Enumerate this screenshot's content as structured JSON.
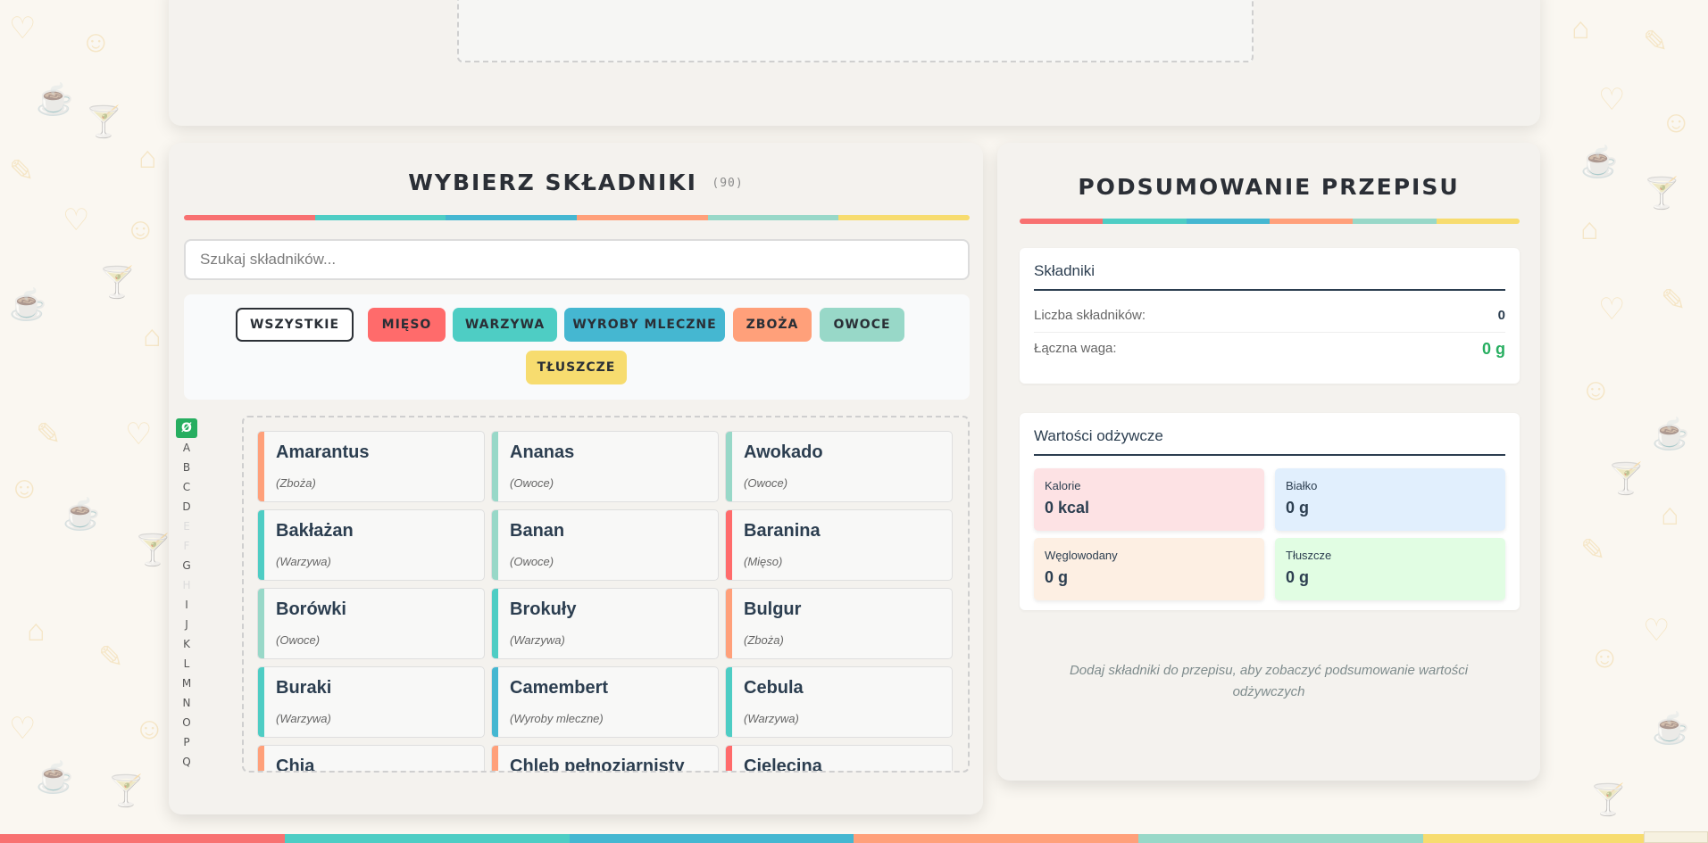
{
  "colors": {
    "stripe": [
      "#f87171",
      "#4ecdc4",
      "#45b7d1",
      "#ffa07a",
      "#98d8c8",
      "#f7dc6f"
    ],
    "chips": {
      "miesa": "#ff6b6b",
      "warzywa": "#4ecdc4",
      "nabial": "#45b7d1",
      "zboza": "#ffa07a",
      "owoce": "#98d8c8",
      "tluszcze": "#f7dc6f"
    }
  },
  "ingredients_panel": {
    "title": "WYBIERZ SKŁADNIKI",
    "count": "(90)",
    "search_placeholder": "Szukaj składników...",
    "filters": [
      {
        "label": "WSZYSTKIE",
        "active": true
      },
      {
        "label": "MIĘSO"
      },
      {
        "label": "WARZYWA"
      },
      {
        "label": "WYROBY MLECZNE"
      },
      {
        "label": "ZBOŻA"
      },
      {
        "label": "OWOCE"
      },
      {
        "label": "TŁUSZCZE"
      }
    ],
    "letters": [
      {
        "char": "Ø",
        "state": "active"
      },
      {
        "char": "A"
      },
      {
        "char": "B"
      },
      {
        "char": "C"
      },
      {
        "char": "D"
      },
      {
        "char": "E",
        "state": "dim"
      },
      {
        "char": "F",
        "state": "dim"
      },
      {
        "char": "G"
      },
      {
        "char": "H",
        "state": "dim"
      },
      {
        "char": "I"
      },
      {
        "char": "J"
      },
      {
        "char": "K"
      },
      {
        "char": "L"
      },
      {
        "char": "M"
      },
      {
        "char": "N"
      },
      {
        "char": "O"
      },
      {
        "char": "P"
      },
      {
        "char": "Q"
      }
    ],
    "items": [
      {
        "name": "Amarantus",
        "category": "(Zboża)",
        "cat": "zboza"
      },
      {
        "name": "Ananas",
        "category": "(Owoce)",
        "cat": "owoce"
      },
      {
        "name": "Awokado",
        "category": "(Owoce)",
        "cat": "owoce"
      },
      {
        "name": "Bakłażan",
        "category": "(Warzywa)",
        "cat": "warzywa"
      },
      {
        "name": "Banan",
        "category": "(Owoce)",
        "cat": "owoce"
      },
      {
        "name": "Baranina",
        "category": "(Mięso)",
        "cat": "miesa"
      },
      {
        "name": "Borówki",
        "category": "(Owoce)",
        "cat": "owoce"
      },
      {
        "name": "Brokuły",
        "category": "(Warzywa)",
        "cat": "warzywa"
      },
      {
        "name": "Bulgur",
        "category": "(Zboża)",
        "cat": "zboza"
      },
      {
        "name": "Buraki",
        "category": "(Warzywa)",
        "cat": "warzywa"
      },
      {
        "name": "Camembert",
        "category": "(Wyroby mleczne)",
        "cat": "nabial"
      },
      {
        "name": "Cebula",
        "category": "(Warzywa)",
        "cat": "warzywa"
      },
      {
        "name": "Chia",
        "category": "",
        "cat": "zboza"
      },
      {
        "name": "Chleb pełnoziarnisty",
        "category": "",
        "cat": "zboza"
      },
      {
        "name": "Cielęcina",
        "category": "",
        "cat": "miesa"
      }
    ]
  },
  "summary_panel": {
    "title": "PODSUMOWANIE PRZEPISU",
    "ingredients_section": {
      "heading": "Składniki",
      "count_label": "Liczba składników:",
      "count_value": "0",
      "weight_label": "Łączna waga:",
      "weight_value": "0 g"
    },
    "nutrition_section": {
      "heading": "Wartości odżywcze",
      "items": [
        {
          "label": "Kalorie",
          "value": "0 kcal",
          "bg": "#fde2e4"
        },
        {
          "label": "Białko",
          "value": "0 g",
          "bg": "#e1effd"
        },
        {
          "label": "Węglowodany",
          "value": "0 g",
          "bg": "#fdefe3"
        },
        {
          "label": "Tłuszcze",
          "value": "0 g",
          "bg": "#e1fde3"
        }
      ]
    },
    "hint": "Dodaj składniki do przepisu, aby zobaczyć podsumowanie wartości odżywczych"
  }
}
